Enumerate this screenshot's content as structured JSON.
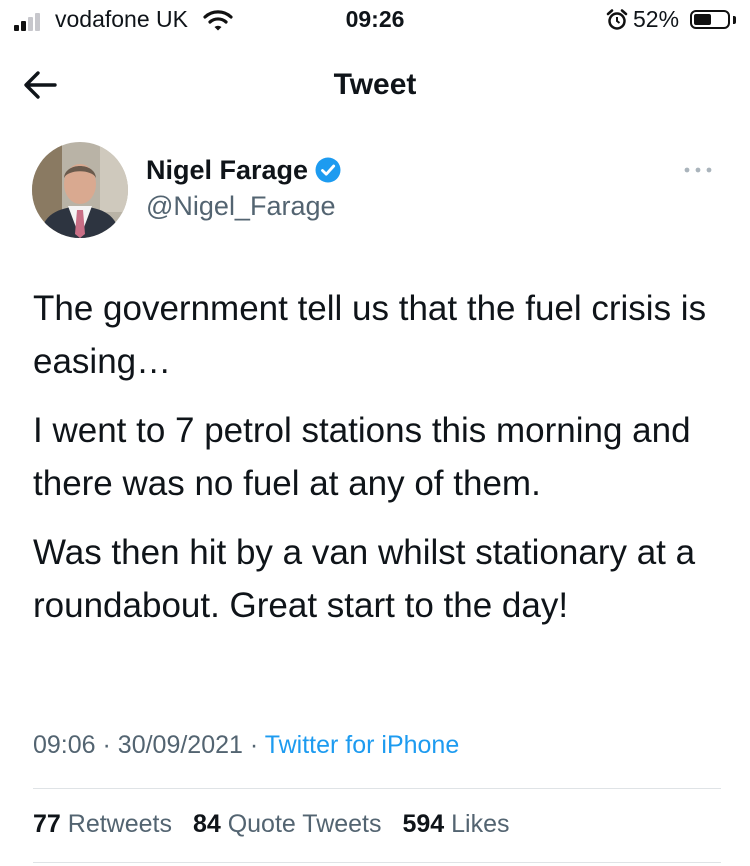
{
  "status_bar": {
    "carrier": "vodafone UK",
    "time": "09:26",
    "battery": "52%",
    "battery_level": 0.52,
    "icons": [
      "signal-icon",
      "wifi-icon",
      "alarm-icon",
      "battery-icon"
    ]
  },
  "nav": {
    "title": "Tweet",
    "back_icon": "arrow-left-icon"
  },
  "tweet": {
    "author_name": "Nigel Farage",
    "handle": "@Nigel_Farage",
    "verified": true,
    "more_icon": "more-horizontal-icon",
    "paragraphs": [
      "The government tell us that the fuel crisis is easing…",
      "I went to 7 petrol stations this morning and there was no fuel at any of them.",
      "Was then hit by a van whilst stationary at a roundabout. Great start to the day!"
    ],
    "time": "09:06",
    "date": "30/09/2021",
    "separator": "·",
    "source": "Twitter for iPhone"
  },
  "stats": {
    "retweets_count": "77",
    "retweets_label": "Retweets",
    "quotes_count": "84",
    "quotes_label": "Quote Tweets",
    "likes_count": "594",
    "likes_label": "Likes"
  },
  "colors": {
    "accent": "#1d9bf0",
    "secondary_text": "#536471",
    "primary_text": "#0f1419",
    "divider": "#dfe3e6"
  }
}
